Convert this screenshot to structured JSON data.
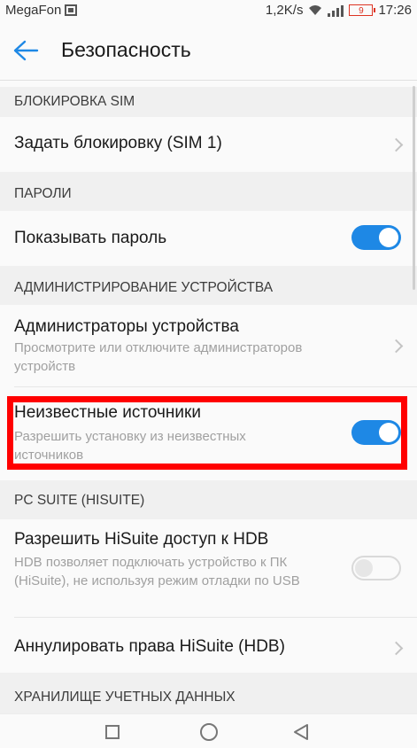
{
  "status_bar": {
    "carrier": "MegaFon",
    "speed": "1,2K/s",
    "battery": "9",
    "time": "17:26",
    "icons": [
      "sim-icon",
      "wifi-icon",
      "signal-icon",
      "battery-icon"
    ]
  },
  "header": {
    "title": "Безопасность",
    "back_icon": "arrow-left-icon"
  },
  "sections": {
    "sim": {
      "header": "БЛОКИРОВКА SIM",
      "items": [
        {
          "title": "Задать блокировку (SIM 1)"
        }
      ]
    },
    "passwords": {
      "header": "ПАРОЛИ",
      "items": [
        {
          "title": "Показывать пароль",
          "toggle": "on"
        }
      ]
    },
    "admin": {
      "header": "АДМИНИСТРИРОВАНИЕ УСТРОЙСТВА",
      "items": [
        {
          "title": "Администраторы устройства",
          "subtitle": "Просмотрите или отключите администраторов устройств"
        },
        {
          "title": "Неизвестные источники",
          "subtitle": "Разрешить установку из неизвестных источников",
          "toggle": "on"
        }
      ]
    },
    "pcsuite": {
      "header": "PC SUITE (HISUITE)",
      "items": [
        {
          "title": "Разрешить HiSuite доступ к HDB",
          "subtitle": "HDB позволяет подключать устройство к ПК (HiSuite), не используя режим отладки по USB",
          "toggle": "off"
        },
        {
          "title": "Аннулировать права HiSuite (HDB)"
        }
      ]
    },
    "storage": {
      "header": "ХРАНИЛИЩЕ УЧЕТНЫХ ДАННЫХ"
    }
  },
  "navbar": {
    "icons": [
      "recent-apps-icon",
      "home-icon",
      "back-icon"
    ]
  },
  "colors": {
    "accent": "#1e88e5",
    "highlight": "#ff0000"
  }
}
